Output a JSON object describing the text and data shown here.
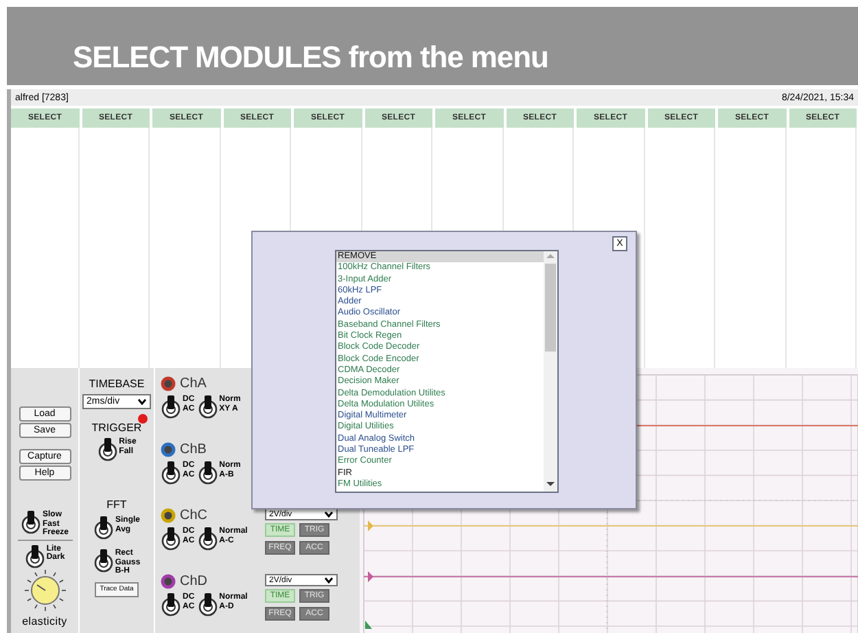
{
  "banner": {
    "title": "SELECT MODULES from the menu"
  },
  "header": {
    "user": "alfred [7283]",
    "datetime": "8/24/2021, 15:34"
  },
  "module_slots": [
    {
      "label": "SELECT"
    },
    {
      "label": "SELECT"
    },
    {
      "label": "SELECT"
    },
    {
      "label": "SELECT"
    },
    {
      "label": "SELECT"
    },
    {
      "label": "SELECT"
    },
    {
      "label": "SELECT"
    },
    {
      "label": "SELECT"
    },
    {
      "label": "SELECT"
    },
    {
      "label": "SELECT"
    },
    {
      "label": "SELECT"
    },
    {
      "label": "SELECT"
    }
  ],
  "panel": {
    "buttons": [
      "Load",
      "Save",
      "Capture",
      "Help"
    ],
    "speed_switch": {
      "labels": [
        "Slow",
        "Fast",
        "Freeze"
      ],
      "on": true
    },
    "theme_switch": {
      "labels": [
        "Lite",
        "Dark"
      ],
      "on": true
    },
    "knob": {
      "label": "elasticity"
    },
    "timebase": {
      "title": "TIMEBASE",
      "value": "2ms/div"
    },
    "trigger": {
      "title": "TRIGGER",
      "led_on": true,
      "switch": {
        "labels": [
          "Rise",
          "Fall"
        ],
        "on": true
      }
    },
    "fft": {
      "title": "FFT",
      "switches": [
        {
          "labels": [
            "Single",
            "Avg"
          ],
          "on": true
        },
        {
          "labels": [
            "Rect",
            "Gauss",
            "B-H"
          ],
          "on": true
        }
      ]
    },
    "trace_button": "Trace Data"
  },
  "channels": [
    {
      "name": "ChA",
      "color": "#c0392b",
      "coupling": {
        "labels": [
          "DC",
          "AC"
        ],
        "on": true
      },
      "mode": {
        "labels": [
          "Norm",
          "XY A"
        ],
        "on": true
      }
    },
    {
      "name": "ChB",
      "color": "#2e6fc0",
      "coupling": {
        "labels": [
          "DC",
          "AC"
        ],
        "on": true
      },
      "mode": {
        "labels": [
          "Norm",
          "A-B"
        ],
        "on": true
      }
    },
    {
      "name": "ChC",
      "color": "#c9a400",
      "coupling": {
        "labels": [
          "DC",
          "AC"
        ],
        "on": true
      },
      "mode": {
        "labels": [
          "Normal",
          "A-C"
        ],
        "on": true
      },
      "scale": "2V/div",
      "buttons": [
        {
          "label": "TIME",
          "selected": true
        },
        {
          "label": "TRIG",
          "selected": false
        },
        {
          "label": "FREQ",
          "selected": false
        },
        {
          "label": "ACC",
          "selected": false
        }
      ]
    },
    {
      "name": "ChD",
      "color": "#a23ba8",
      "coupling": {
        "labels": [
          "DC",
          "AC"
        ],
        "on": true
      },
      "mode": {
        "labels": [
          "Normal",
          "A-D"
        ],
        "on": true
      },
      "scale": "2V/div",
      "buttons": [
        {
          "label": "TIME",
          "selected": true
        },
        {
          "label": "TRIG",
          "selected": false
        },
        {
          "label": "FREQ",
          "selected": false
        },
        {
          "label": "ACC",
          "selected": false
        }
      ]
    }
  ],
  "dialog": {
    "close": "X",
    "list": [
      {
        "label": "REMOVE",
        "selected": true,
        "color": "#111111"
      },
      {
        "label": "100kHz Channel Filters",
        "selected": false,
        "color": "#2e7d4f"
      },
      {
        "label": "3-Input Adder",
        "selected": false,
        "color": "#2e7d4f"
      },
      {
        "label": "60kHz LPF",
        "selected": false,
        "color": "#2b4f8f"
      },
      {
        "label": "Adder",
        "selected": false,
        "color": "#2b4f8f"
      },
      {
        "label": "Audio Oscillator",
        "selected": false,
        "color": "#2b4f8f"
      },
      {
        "label": "Baseband Channel Filters",
        "selected": false,
        "color": "#2e7d4f"
      },
      {
        "label": "Bit Clock Regen",
        "selected": false,
        "color": "#2e7d4f"
      },
      {
        "label": "Block Code Decoder",
        "selected": false,
        "color": "#2e7d4f"
      },
      {
        "label": "Block Code Encoder",
        "selected": false,
        "color": "#2e7d4f"
      },
      {
        "label": "CDMA Decoder",
        "selected": false,
        "color": "#2e7d4f"
      },
      {
        "label": "Decision Maker",
        "selected": false,
        "color": "#2e7d4f"
      },
      {
        "label": "Delta Demodulation Utilites",
        "selected": false,
        "color": "#2e7d4f"
      },
      {
        "label": "Delta Modulation Utilites",
        "selected": false,
        "color": "#2e7d4f"
      },
      {
        "label": "Digital Multimeter",
        "selected": false,
        "color": "#2b4f8f"
      },
      {
        "label": "Digital Utilities",
        "selected": false,
        "color": "#2e7d4f"
      },
      {
        "label": "Dual Analog Switch",
        "selected": false,
        "color": "#2b4f8f"
      },
      {
        "label": "Dual Tuneable LPF",
        "selected": false,
        "color": "#2b4f8f"
      },
      {
        "label": "Error Counter",
        "selected": false,
        "color": "#2e7d4f"
      },
      {
        "label": "FIR",
        "selected": false,
        "color": "#111111"
      },
      {
        "label": "FM Utilities",
        "selected": false,
        "color": "#2e7d4f"
      }
    ]
  }
}
